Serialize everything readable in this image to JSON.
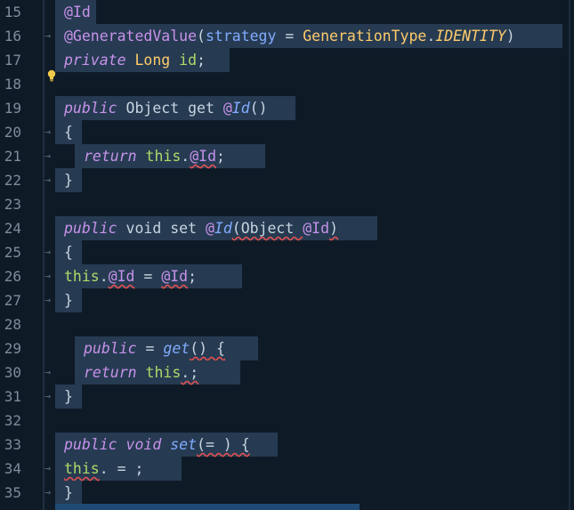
{
  "lines": [
    {
      "n": "15",
      "segs": [
        [
          "ann",
          "@Id"
        ]
      ]
    },
    {
      "n": "16",
      "segs": [
        [
          "ann",
          "@GeneratedValue"
        ],
        [
          "plain",
          "("
        ],
        [
          "param",
          "strategy"
        ],
        [
          "plain",
          " = "
        ],
        [
          "ty",
          "GenerationType"
        ],
        [
          "plain",
          "."
        ],
        [
          "en",
          "IDENTITY"
        ],
        [
          "plain",
          ")"
        ]
      ]
    },
    {
      "n": "17",
      "segs": [
        [
          "kw",
          "private"
        ],
        [
          "plain",
          " "
        ],
        [
          "ty",
          "Long"
        ],
        [
          "plain",
          " "
        ],
        [
          "id",
          "id"
        ],
        [
          "plain",
          ";"
        ]
      ]
    },
    {
      "n": "18",
      "segs": []
    },
    {
      "n": "19",
      "segs": [
        [
          "kw",
          "public"
        ],
        [
          "plain",
          " Object get "
        ],
        [
          "ann",
          "@"
        ],
        [
          "fn",
          "Id"
        ],
        [
          "plain",
          "()"
        ]
      ]
    },
    {
      "n": "20",
      "segs": [
        [
          "plain",
          "{"
        ]
      ]
    },
    {
      "n": "21",
      "segs": [
        [
          "kw",
          "return"
        ],
        [
          "plain",
          " "
        ],
        [
          "id",
          "this"
        ],
        [
          "plain",
          "."
        ],
        [
          "ann",
          "@"
        ],
        [
          "ann",
          "Id"
        ],
        [
          "plain",
          ";"
        ]
      ]
    },
    {
      "n": "22",
      "segs": [
        [
          "plain",
          "}"
        ]
      ]
    },
    {
      "n": "23",
      "segs": []
    },
    {
      "n": "24",
      "segs": [
        [
          "kw",
          "public"
        ],
        [
          "plain",
          " void set "
        ],
        [
          "ann",
          "@"
        ],
        [
          "fn",
          "Id"
        ],
        [
          "plain",
          "(Object "
        ],
        [
          "ann",
          "@Id"
        ],
        [
          "plain",
          ")"
        ]
      ]
    },
    {
      "n": "25",
      "segs": [
        [
          "plain",
          "{"
        ]
      ]
    },
    {
      "n": "26",
      "segs": [
        [
          "id",
          "this"
        ],
        [
          "plain",
          "."
        ],
        [
          "ann",
          "@Id"
        ],
        [
          "plain",
          " = "
        ],
        [
          "ann",
          "@Id"
        ],
        [
          "plain",
          ";"
        ]
      ]
    },
    {
      "n": "27",
      "segs": [
        [
          "plain",
          "}"
        ]
      ]
    },
    {
      "n": "28",
      "segs": []
    },
    {
      "n": "29",
      "segs": [
        [
          "kw",
          "public"
        ],
        [
          "plain",
          " = "
        ],
        [
          "fn",
          "get"
        ],
        [
          "plain",
          "() {"
        ]
      ]
    },
    {
      "n": "30",
      "segs": [
        [
          "kw",
          "return"
        ],
        [
          "plain",
          " "
        ],
        [
          "id",
          "this"
        ],
        [
          "plain",
          ".;"
        ]
      ]
    },
    {
      "n": "31",
      "segs": [
        [
          "plain",
          "}"
        ]
      ]
    },
    {
      "n": "32",
      "segs": []
    },
    {
      "n": "33",
      "segs": [
        [
          "kw",
          "public"
        ],
        [
          "plain",
          " "
        ],
        [
          "kw",
          "void"
        ],
        [
          "plain",
          " "
        ],
        [
          "fn",
          "set"
        ],
        [
          "plain",
          "(= ) {"
        ]
      ]
    },
    {
      "n": "34",
      "segs": [
        [
          "id",
          "this"
        ],
        [
          "plain",
          ". = ;"
        ]
      ]
    },
    {
      "n": "35",
      "segs": [
        [
          "plain",
          "}"
        ]
      ]
    }
  ],
  "colors": {
    "background": "#0e1a26",
    "selection": "#263b52",
    "keyword": "#c792ea",
    "type": "#ffcb6b",
    "function": "#82aaff",
    "identifier": "#addb67",
    "error_squiggle": "#e05050"
  },
  "icons": {
    "hint": "lightbulb-icon",
    "indent_guide": "tab-arrow-icon"
  }
}
